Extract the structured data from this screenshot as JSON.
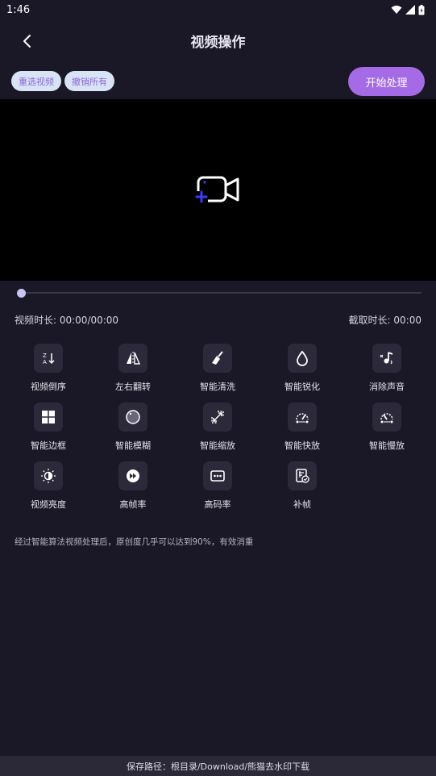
{
  "status_bar": {
    "time": "1:46",
    "icons": [
      "wifi-icon",
      "signal-icon",
      "battery-icon"
    ]
  },
  "header": {
    "title": "视频操作",
    "back_icon": "chevron-left-icon"
  },
  "toolbar": {
    "reselect_label": "重选视频",
    "undo_all_label": "撤销所有",
    "start_label": "开始处理"
  },
  "video": {
    "add_icon": "add-video-icon"
  },
  "timeline": {
    "progress": 0,
    "duration_text": "视频时长: 00:00/00:00",
    "clip_text": "截取时长: 00:00"
  },
  "tools": [
    {
      "label": "视频倒序",
      "icon": "reverse-sort-icon"
    },
    {
      "label": "左右翻转",
      "icon": "flip-horizontal-icon"
    },
    {
      "label": "智能清洗",
      "icon": "broom-icon"
    },
    {
      "label": "智能锐化",
      "icon": "droplet-icon"
    },
    {
      "label": "消除声音",
      "icon": "mute-music-icon"
    },
    {
      "label": "智能边框",
      "icon": "grid-frame-icon"
    },
    {
      "label": "智能模糊",
      "icon": "blur-circle-icon"
    },
    {
      "label": "智能缩放",
      "icon": "scale-arrows-icon"
    },
    {
      "label": "智能快放",
      "icon": "fast-speed-icon"
    },
    {
      "label": "智能慢放",
      "icon": "slow-speed-icon"
    },
    {
      "label": "视频亮度",
      "icon": "brightness-icon"
    },
    {
      "label": "高帧率",
      "icon": "fast-forward-icon"
    },
    {
      "label": "高码率",
      "icon": "bitrate-icon"
    },
    {
      "label": "补帧",
      "icon": "frame-fill-icon"
    }
  ],
  "note": "经过智能算法视频处理后，原创度几乎可以达到90%，有效消重",
  "footer": {
    "save_path": "保存路径：根目录/Download/熊猫去水印下载"
  },
  "colors": {
    "background": "#1a1726",
    "accent": "#a56be6",
    "chip_bg": "#d8e4f6",
    "chip_text": "#8b67d6",
    "tile_bg": "#2c2a3a"
  }
}
